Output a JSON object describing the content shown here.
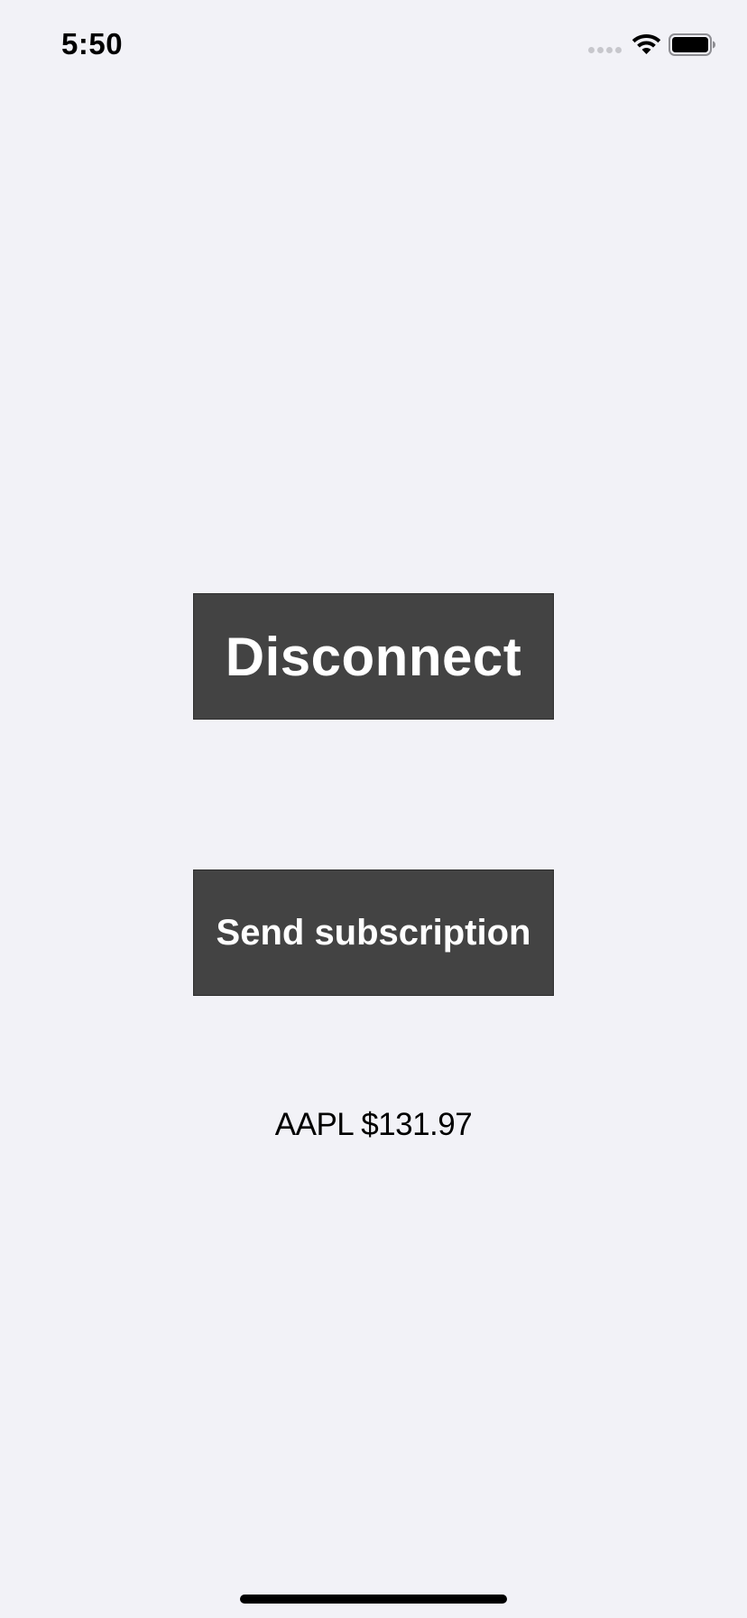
{
  "status_bar": {
    "time": "5:50"
  },
  "buttons": {
    "disconnect_label": "Disconnect",
    "send_subscription_label": "Send subscription"
  },
  "quote": {
    "text": "AAPL $131.97"
  },
  "colors": {
    "background": "#f2f2f7",
    "button_background": "#434343",
    "button_text": "#ffffff",
    "text": "#000000"
  }
}
